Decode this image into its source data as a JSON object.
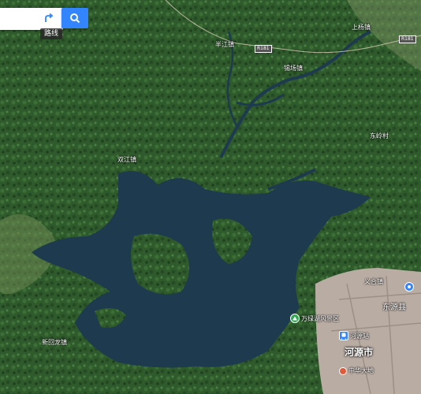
{
  "search": {
    "placeholder": "",
    "route_tooltip": "路线"
  },
  "icons": {
    "route": "route-icon",
    "search": "search-icon",
    "scenic": "scenic-spot-icon",
    "station": "station-icon",
    "government": "government-icon"
  },
  "colors": {
    "search_button": "#3385ff",
    "water": "#1d3a4f",
    "forest": "#2f5a2c",
    "urban": "#b9aca3"
  },
  "roads": {
    "r1": "R181",
    "r2": "R181"
  },
  "places": {
    "p1": "半江镇",
    "p2": "锡场镇",
    "p3": "上杨镇",
    "p4": "东岭村",
    "p5": "双江镇",
    "p6": "新回龙镇",
    "p7": "义合镇"
  },
  "scenic": {
    "label": "万绿湖风景区"
  },
  "station": {
    "label": "河源站"
  },
  "county": {
    "label": "东源县"
  },
  "city": {
    "label": "河源市"
  },
  "district": {
    "label": "中华大地"
  }
}
